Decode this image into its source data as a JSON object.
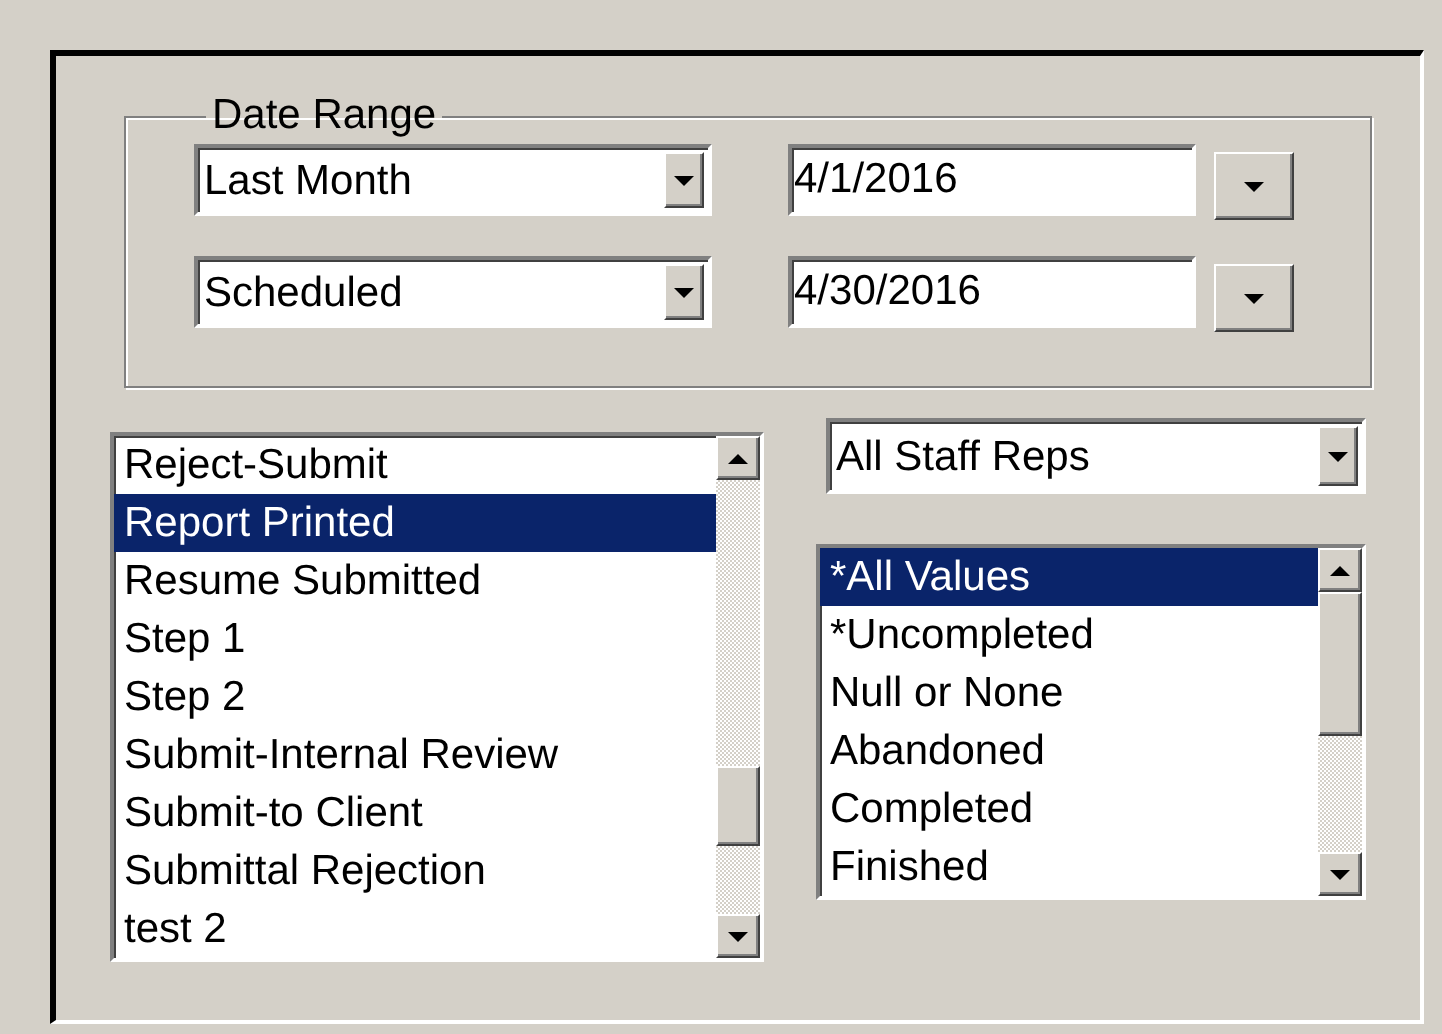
{
  "date_range": {
    "title": "Date Range",
    "rows": [
      {
        "period": "Last Month",
        "date": "4/1/2016"
      },
      {
        "period": "Scheduled",
        "date": "4/30/2016"
      }
    ]
  },
  "status_list": {
    "items": [
      {
        "label": "Reject-Submit",
        "selected": false
      },
      {
        "label": "Report Printed",
        "selected": true
      },
      {
        "label": "Resume Submitted",
        "selected": false
      },
      {
        "label": "Step 1",
        "selected": false
      },
      {
        "label": "Step 2",
        "selected": false
      },
      {
        "label": "Submit-Internal Review",
        "selected": false
      },
      {
        "label": "Submit-to Client",
        "selected": false
      },
      {
        "label": "Submittal Rejection",
        "selected": false
      },
      {
        "label": "test 2",
        "selected": false
      }
    ]
  },
  "staff_dropdown": {
    "value": "All Staff Reps"
  },
  "value_list": {
    "items": [
      {
        "label": "*All Values",
        "selected": true
      },
      {
        "label": "*Uncompleted",
        "selected": false
      },
      {
        "label": "Null or None",
        "selected": false
      },
      {
        "label": "Abandoned",
        "selected": false
      },
      {
        "label": "Completed",
        "selected": false
      },
      {
        "label": "Finished",
        "selected": false
      }
    ]
  }
}
